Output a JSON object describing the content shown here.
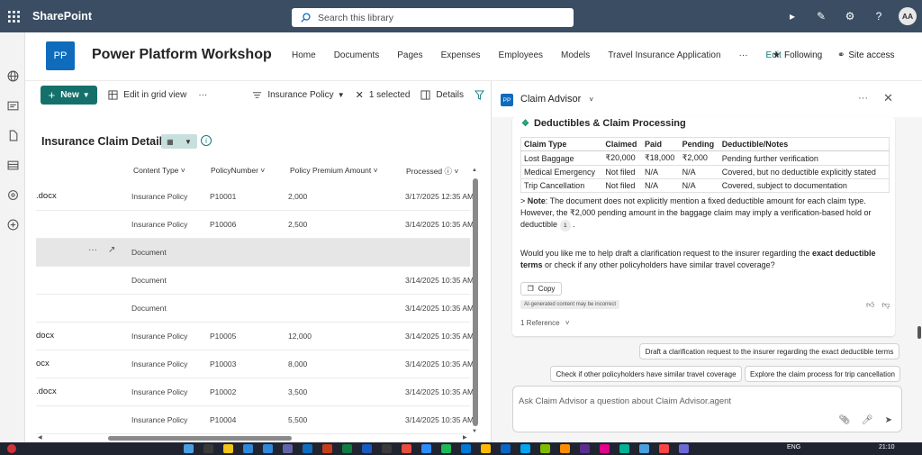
{
  "suite": {
    "app_name": "SharePoint",
    "search_placeholder": "Search this library",
    "avatar_initials": "AA"
  },
  "site": {
    "logo_text": "PP",
    "title": "Power Platform Workshop",
    "nav": [
      "Home",
      "Documents",
      "Pages",
      "Expenses",
      "Employees",
      "Models",
      "Travel Insurance Application",
      "···",
      "Edit"
    ],
    "following": "Following",
    "site_access": "Site access"
  },
  "command_bar": {
    "new_label": "New",
    "edit_grid": "Edit in grid view",
    "more": "···",
    "view_name": "Insurance Policy",
    "selected": "1 selected",
    "details": "Details"
  },
  "list": {
    "title": "Insurance Claim Details",
    "columns": [
      "Content Type",
      "PolicyNumber",
      "Policy Premium Amount",
      "Processed"
    ],
    "rows": [
      {
        "name": ".docx",
        "content_type": "Insurance Policy",
        "policy": "P10001",
        "premium": "2,000",
        "processed": "3/17/2025 12:35 AM"
      },
      {
        "name": "",
        "content_type": "Insurance Policy",
        "policy": "P10006",
        "premium": "2,500",
        "processed": "3/14/2025 10:35 AM"
      },
      {
        "name": "",
        "content_type": "Document",
        "policy": "",
        "premium": "",
        "processed": ""
      },
      {
        "name": "",
        "content_type": "Document",
        "policy": "",
        "premium": "",
        "processed": "3/14/2025 10:35 AM"
      },
      {
        "name": "",
        "content_type": "Document",
        "policy": "",
        "premium": "",
        "processed": "3/14/2025 10:35 AM"
      },
      {
        "name": "docx",
        "content_type": "Insurance Policy",
        "policy": "P10005",
        "premium": "12,000",
        "processed": "3/14/2025 10:35 AM"
      },
      {
        "name": "ocx",
        "content_type": "Insurance Policy",
        "policy": "P10003",
        "premium": "8,000",
        "processed": "3/14/2025 10:35 AM"
      },
      {
        "name": ".docx",
        "content_type": "Insurance Policy",
        "policy": "P10002",
        "premium": "3,500",
        "processed": "3/14/2025 10:35 AM"
      },
      {
        "name": "",
        "content_type": "Insurance Policy",
        "policy": "P10004",
        "premium": "5,500",
        "processed": "3/14/2025 10:35 AM"
      }
    ]
  },
  "advisor": {
    "logo_text": "PP",
    "title": "Claim Advisor",
    "heading": "Deductibles & Claim Processing",
    "table_headers": [
      "Claim Type",
      "Claimed",
      "Paid",
      "Pending",
      "Deductible/Notes"
    ],
    "table_rows": [
      [
        "Lost Baggage",
        "₹20,000",
        "₹18,000",
        "₹2,000",
        "Pending further verification"
      ],
      [
        "Medical Emergency",
        "Not filed",
        "N/A",
        "N/A",
        "Covered, but no deductible explicitly stated"
      ],
      [
        "Trip Cancellation",
        "Not filed",
        "N/A",
        "N/A",
        "Covered, subject to documentation"
      ]
    ],
    "note_prefix": "> ",
    "note_label": "Note",
    "note_text": ": The document does not explicitly mention a fixed deductible amount for each claim type. However, the ₹2,000 pending amount in the baggage claim may imply a verification-based hold or deductible",
    "note_ref": "1",
    "question_start": "Would you like me to help draft a clarification request to the insurer regarding the ",
    "question_bold1": "exact deductible terms",
    "question_end": " or check if any other policyholders have similar travel coverage?",
    "copy_label": "Copy",
    "ai_tag": "AI-generated content may be incorrect",
    "references": "1 Reference",
    "suggestions": [
      "Draft a clarification request to the insurer regarding the exact deductible terms",
      "Check if other policyholders have similar travel coverage",
      "Explore the claim process for trip cancellation"
    ],
    "ask_placeholder": "Ask Claim Advisor a question about Claim Advisor.agent"
  },
  "taskbar": {
    "language": "ENG",
    "time": "21:10"
  }
}
